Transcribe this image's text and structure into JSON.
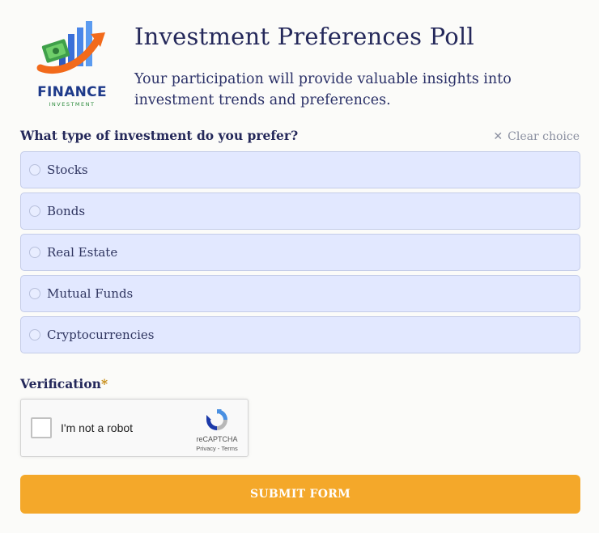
{
  "logo": {
    "name": "FINANCE",
    "tagline": "INVESTMENT"
  },
  "header": {
    "title": "Investment Preferences Poll",
    "subtitle": "Your participation will provide valuable insights into investment trends and preferences."
  },
  "question": {
    "label": "What type of investment do you prefer?",
    "clear_label": "Clear choice",
    "options": [
      "Stocks",
      "Bonds",
      "Real Estate",
      "Mutual Funds",
      "Cryptocurrencies"
    ]
  },
  "verification": {
    "label": "Verification",
    "required_mark": "*",
    "captcha_text": "I'm not a robot",
    "captcha_brand": "reCAPTCHA",
    "captcha_links": "Privacy - Terms"
  },
  "submit": {
    "label": "SUBMIT FORM"
  },
  "colors": {
    "accent": "#f4a82a",
    "option_bg": "#e2e8ff",
    "heading": "#24285a"
  }
}
